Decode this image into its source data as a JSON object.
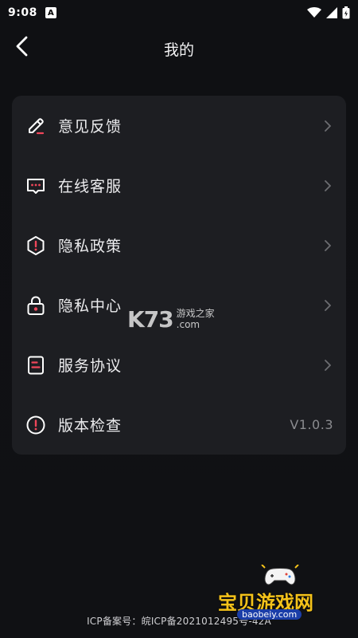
{
  "status": {
    "time": "9:08",
    "badge": "A"
  },
  "header": {
    "title": "我的"
  },
  "menu": [
    {
      "label": "意见反馈"
    },
    {
      "label": "在线客服"
    },
    {
      "label": "隐私政策"
    },
    {
      "label": "隐私中心"
    },
    {
      "label": "服务协议"
    },
    {
      "label": "版本检查"
    }
  ],
  "version": "V1.0.3",
  "footer": {
    "icp": "ICP备案号：皖ICP备2021012495号-42A"
  },
  "watermarks": {
    "center_logo": "K73",
    "center_cn": "游戏之家",
    "center_com": ".com",
    "bottom_cn": "宝贝游戏网",
    "bottom_url": "baobeiy.com"
  },
  "colors": {
    "accent": "#f0465a",
    "background": "#0f1013",
    "card": "#1d1e22"
  },
  "icons": [
    "edit-icon",
    "chat-icon",
    "shield-alert-icon",
    "lock-icon",
    "document-icon",
    "info-icon",
    "chevron-right-icon",
    "back-icon",
    "wifi-icon",
    "signal-icon",
    "battery-icon"
  ]
}
